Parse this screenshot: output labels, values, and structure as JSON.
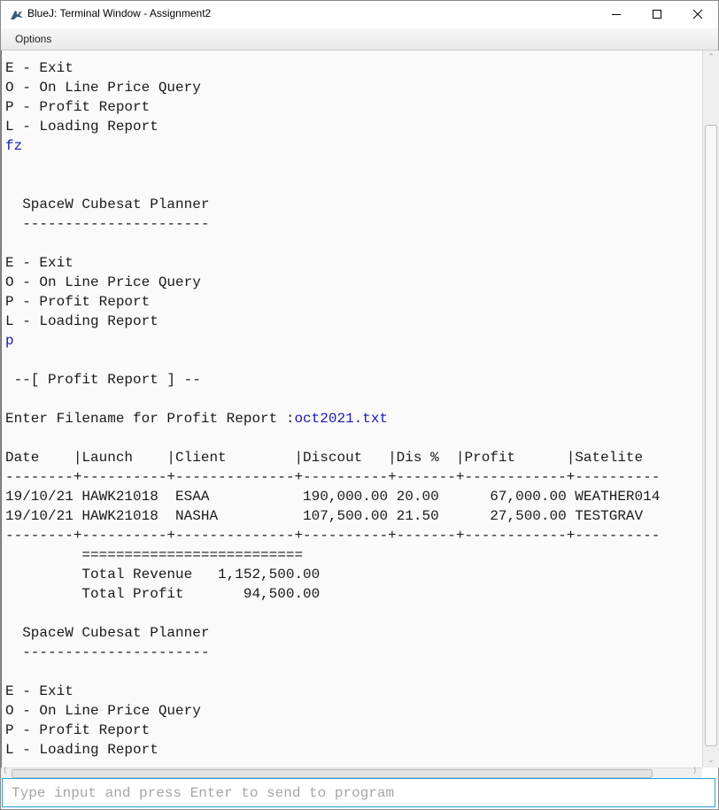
{
  "window": {
    "title": "BlueJ: Terminal Window - Assignment2",
    "controls": {
      "minimize": "minimize-icon",
      "maximize": "maximize-icon",
      "close": "close-icon"
    }
  },
  "menu": {
    "items": [
      {
        "label": "Options"
      }
    ]
  },
  "terminal": {
    "lines": [
      {
        "text": "E - Exit",
        "type": "output"
      },
      {
        "text": "O - On Line Price Query",
        "type": "output"
      },
      {
        "text": "P - Profit Report",
        "type": "output"
      },
      {
        "text": "L - Loading Report",
        "type": "output"
      },
      {
        "text": "fz",
        "type": "input"
      },
      {
        "text": "",
        "type": "output"
      },
      {
        "text": "",
        "type": "output"
      },
      {
        "text": "  SpaceW Cubesat Planner",
        "type": "output"
      },
      {
        "text": "  ----------------------",
        "type": "output"
      },
      {
        "text": "",
        "type": "output"
      },
      {
        "text": "E - Exit",
        "type": "output"
      },
      {
        "text": "O - On Line Price Query",
        "type": "output"
      },
      {
        "text": "P - Profit Report",
        "type": "output"
      },
      {
        "text": "L - Loading Report",
        "type": "output"
      },
      {
        "text": "p",
        "type": "input"
      },
      {
        "text": "",
        "type": "output"
      },
      {
        "text": " --[ Profit Report ] --",
        "type": "output"
      },
      {
        "text": "",
        "type": "output"
      },
      {
        "text": "Enter Filename for Profit Report :",
        "type": "prompt",
        "input": "oct2021.txt"
      },
      {
        "text": "",
        "type": "output"
      },
      {
        "text": "Date    |Launch    |Client        |Discout   |Dis %  |Profit      |Satelite",
        "type": "output"
      },
      {
        "text": "--------+----------+--------------+----------+-------+------------+----------",
        "type": "output"
      },
      {
        "text": "19/10/21 HAWK21018  ESAA           190,000.00 20.00      67,000.00 WEATHER014",
        "type": "output"
      },
      {
        "text": "19/10/21 HAWK21018  NASHA          107,500.00 21.50      27,500.00 TESTGRAV",
        "type": "output"
      },
      {
        "text": "--------+----------+--------------+----------+-------+------------+----------",
        "type": "output"
      },
      {
        "text": "         ==========================",
        "type": "output"
      },
      {
        "text": "         Total Revenue   1,152,500.00",
        "type": "output"
      },
      {
        "text": "         Total Profit       94,500.00",
        "type": "output"
      },
      {
        "text": "",
        "type": "output"
      },
      {
        "text": "  SpaceW Cubesat Planner",
        "type": "output"
      },
      {
        "text": "  ----------------------",
        "type": "output"
      },
      {
        "text": "",
        "type": "output"
      },
      {
        "text": "E - Exit",
        "type": "output"
      },
      {
        "text": "O - On Line Price Query",
        "type": "output"
      },
      {
        "text": "P - Profit Report",
        "type": "output"
      },
      {
        "text": "L - Loading Report",
        "type": "output"
      }
    ]
  },
  "input": {
    "value": "",
    "placeholder": "Type input and press Enter to send to program"
  },
  "colors": {
    "input_text": "#1a1ab0",
    "focus_border": "#2a9fd6"
  }
}
